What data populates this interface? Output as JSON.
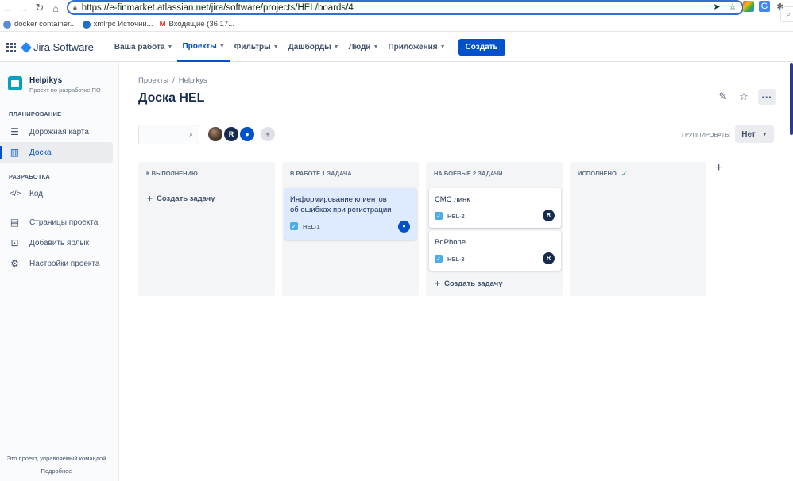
{
  "browser": {
    "url": "https://e-finmarket.atlassian.net/jira/software/projects/HEL/boards/4",
    "bookmarks": [
      {
        "label": "docker container..."
      },
      {
        "label": "xmlrpc Источни..."
      },
      {
        "label": "Входящие (36 17..."
      }
    ]
  },
  "topnav": {
    "brand": "Jira Software",
    "menu": [
      {
        "label": "Ваша работа"
      },
      {
        "label": "Проекты"
      },
      {
        "label": "Фильтры"
      },
      {
        "label": "Дашборды"
      },
      {
        "label": "Люди"
      },
      {
        "label": "Приложения"
      }
    ],
    "create_label": "Создать"
  },
  "sidebar": {
    "project_name": "Helpikys",
    "project_sub": "Проект по разработке ПО",
    "section_planning": "ПЛАНИРОВАНИЕ",
    "section_dev": "РАЗРАБОТКА",
    "items": [
      {
        "label": "Дорожная карта"
      },
      {
        "label": "Доска"
      },
      {
        "label": "Код"
      },
      {
        "label": "Страницы проекта"
      },
      {
        "label": "Добавить ярлык"
      },
      {
        "label": "Настройки проекта"
      }
    ],
    "footer_text": "Это проект, управляемый командой",
    "footer_link": "Подробнее"
  },
  "main": {
    "breadcrumb": [
      "Проекты",
      "/",
      "Helpikys"
    ],
    "title": "Доска HEL",
    "grouping_label": "ГРУППИРОВАТЬ:",
    "grouping_value": "Нет",
    "avatar_r": "R",
    "columns": [
      {
        "title": "К ВЫПОЛНЕНИЮ",
        "create": "Создать задачу"
      },
      {
        "title": "В РАБОТЕ 1 ЗАДАЧА"
      },
      {
        "title": "НА БОЕВЫЕ 2 ЗАДАЧИ",
        "create": "Создать задачу"
      },
      {
        "title": "ИСПОЛНЕНО"
      }
    ],
    "cards": [
      {
        "summary": "Информирование клиентов об ошибках при регистрации",
        "key": "HEL-1"
      },
      {
        "summary": "СМС линк",
        "key": "HEL-2",
        "assignee": "R"
      },
      {
        "summary": "BdPhone",
        "key": "HEL-3",
        "assignee": "R"
      }
    ]
  },
  "colors": {
    "accent": "#0052cc",
    "column_bg": "#f4f5f7",
    "selected_card": "#deebff"
  }
}
